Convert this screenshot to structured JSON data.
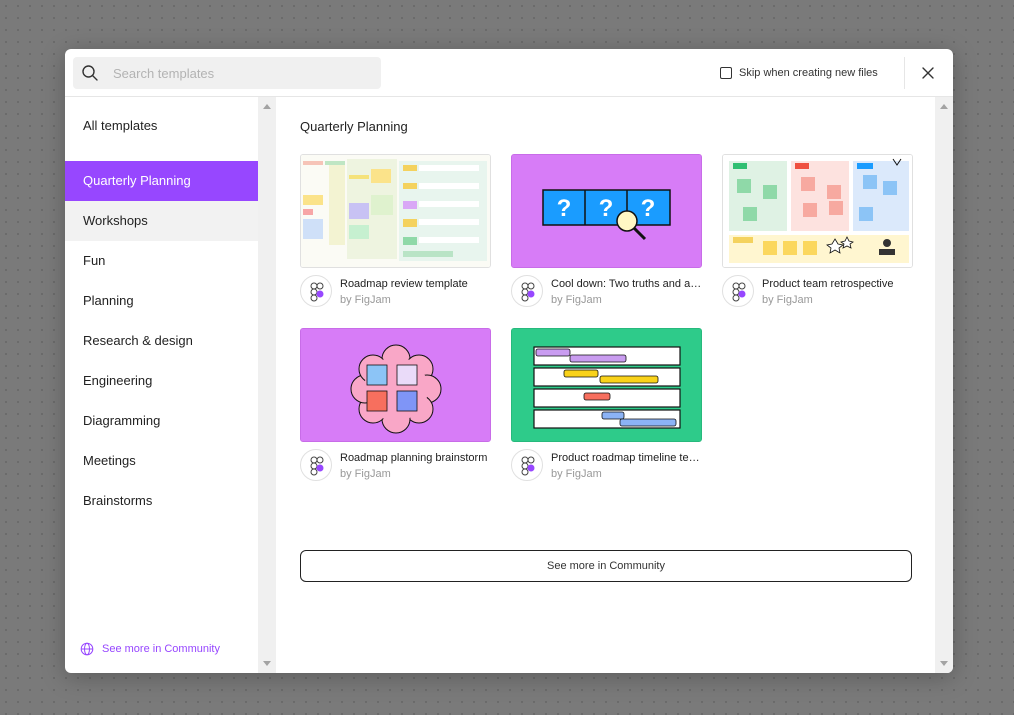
{
  "search": {
    "placeholder": "Search templates"
  },
  "skip_checkbox": {
    "label": "Skip when creating new files",
    "checked": false
  },
  "sidebar": {
    "all_templates": "All templates",
    "items": [
      {
        "label": "Quarterly Planning",
        "state": "active"
      },
      {
        "label": "Workshops",
        "state": "hover"
      },
      {
        "label": "Fun"
      },
      {
        "label": "Planning"
      },
      {
        "label": "Research & design"
      },
      {
        "label": "Engineering"
      },
      {
        "label": "Diagramming"
      },
      {
        "label": "Meetings"
      },
      {
        "label": "Brainstorms"
      }
    ],
    "community_link": "See more in Community"
  },
  "main": {
    "section_title": "Quarterly Planning",
    "cards": [
      {
        "title": "Roadmap review template",
        "author": "by FigJam",
        "thumb": "roadmap-review-thumbnail"
      },
      {
        "title": "Cool down: Two truths and a lie",
        "author": "by FigJam",
        "thumb": "question-marks-thumbnail"
      },
      {
        "title": "Product team retrospective",
        "author": "by FigJam",
        "thumb": "retrospective-board-thumbnail"
      },
      {
        "title": "Roadmap planning brainstorm",
        "author": "by FigJam",
        "thumb": "sticky-notes-flower-thumbnail"
      },
      {
        "title": "Product roadmap timeline template",
        "author": "by FigJam",
        "thumb": "timeline-bars-thumbnail"
      }
    ],
    "see_more_button": "See more in Community"
  },
  "colors": {
    "accent": "#9747ff",
    "purple_thumb": "#d77cf7",
    "green_thumb": "#2ecb8a",
    "text": "#222222",
    "muted": "#999999"
  },
  "icons": {
    "search": "search-icon",
    "close": "close-icon",
    "globe": "globe-icon",
    "avatar": "figjam-logo-icon"
  }
}
